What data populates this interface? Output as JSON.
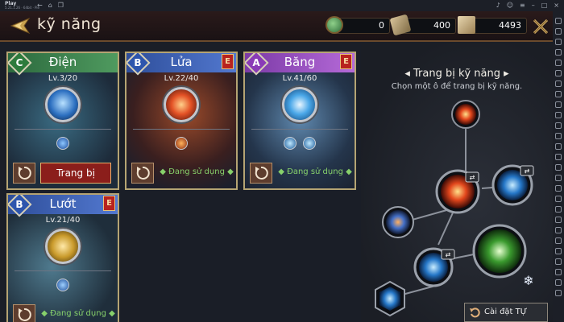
{
  "emulator": {
    "app_name": "Play",
    "app_sub": "5.21.1.26 · 64bit · Pie",
    "nav_icons": [
      "back-icon",
      "home-icon",
      "copy-icon"
    ],
    "window_icons": [
      "bell-icon",
      "user-icon",
      "menu-icon",
      "minimize-icon",
      "maximize-icon",
      "close-icon"
    ]
  },
  "header": {
    "title": "kỹ năng",
    "resources": [
      {
        "icon": "jade-icon",
        "value": "0"
      },
      {
        "icon": "scroll-icon",
        "value": "400"
      },
      {
        "icon": "book-icon",
        "value": "4493"
      }
    ]
  },
  "cards": [
    {
      "id": "dien",
      "name": "Điện",
      "grade": "C",
      "level": "Lv.3/20",
      "badge": "",
      "element": "lightning",
      "status": "",
      "action": "Trang bị"
    },
    {
      "id": "lua",
      "name": "Lửa",
      "grade": "B",
      "level": "Lv.22/40",
      "badge": "E",
      "element": "fire",
      "status": "◆ Đang sử dụng ◆",
      "action": ""
    },
    {
      "id": "bang",
      "name": "Băng",
      "grade": "A",
      "level": "Lv.41/60",
      "badge": "E",
      "element": "ice",
      "status": "◆ Đang sử dụng ◆",
      "action": ""
    },
    {
      "id": "luot",
      "name": "Lướt",
      "grade": "B",
      "level": "Lv.21/40",
      "badge": "E",
      "element": "dash",
      "status": "◆ Đang sử dụng ◆",
      "action": ""
    }
  ],
  "panel": {
    "title": "◂ Trang bị kỹ năng ▸",
    "subtitle": "Chọn một ô để trang bị kỹ năng.",
    "auto_button": "Cài đặt TỰ ĐỘNG"
  },
  "colors": {
    "accent_gold": "#b5a473",
    "status_green": "#87d16b",
    "equip_red": "#8b1e1b",
    "grade_c": "#2d7b3c",
    "grade_b": "#2d55ad",
    "grade_a": "#8a3bb7"
  }
}
